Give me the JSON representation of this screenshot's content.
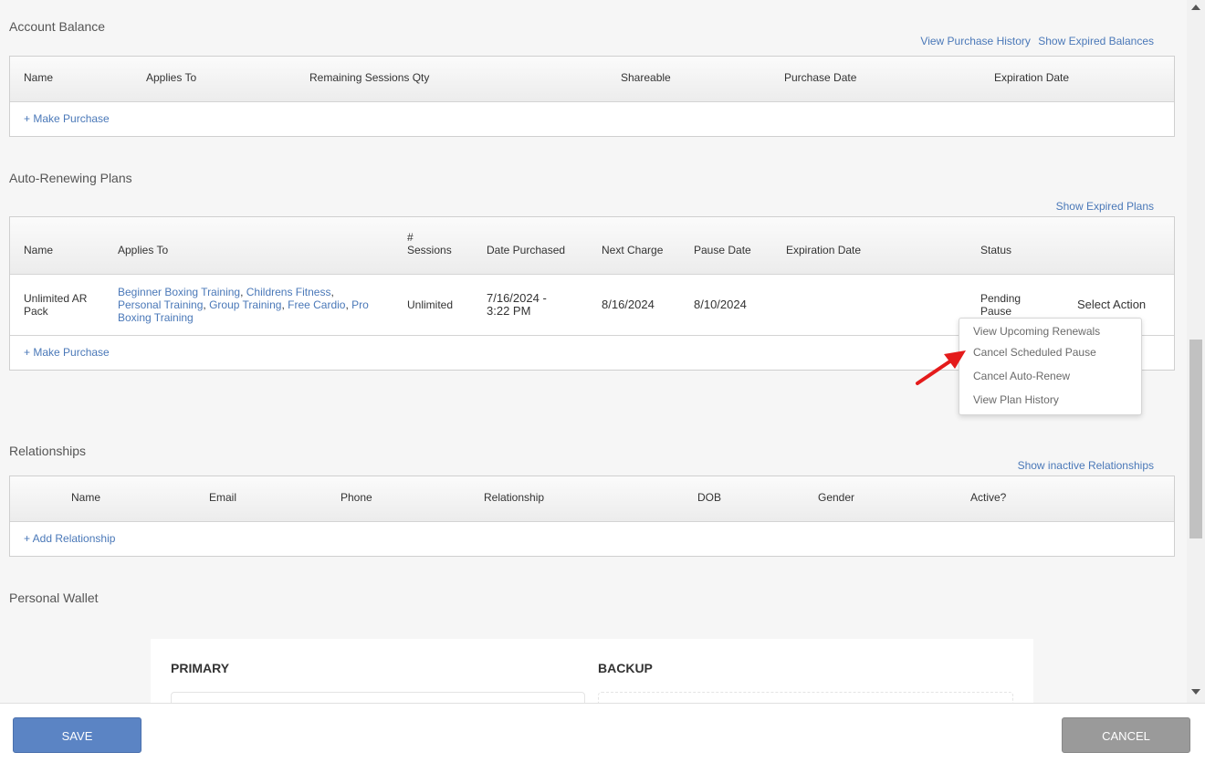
{
  "account_balance": {
    "title": "Account Balance",
    "links": [
      "View Purchase History",
      "Show Expired Balances"
    ],
    "columns": [
      "Name",
      "Applies To",
      "Remaining Sessions Qty",
      "Shareable",
      "Purchase Date",
      "Expiration Date"
    ],
    "make_purchase": "+ Make Purchase"
  },
  "auto_renewing": {
    "title": "Auto-Renewing Plans",
    "link": "Show Expired Plans",
    "columns": [
      "Name",
      "Applies To",
      "#",
      "Sessions",
      "Date Purchased",
      "Next Charge",
      "Pause Date",
      "Expiration Date",
      "Status"
    ],
    "row": {
      "name_line1": "Unlimited AR",
      "name_line2": "Pack",
      "applies_1": "Beginner Boxing Training",
      "applies_2": "Childrens Fitness",
      "applies_3": "Personal Training",
      "applies_4": "Group Training",
      "applies_5": "Free Cardio",
      "applies_6": "Pro",
      "applies_7": "Boxing Training",
      "sessions": "Unlimited",
      "date_line1": "7/16/2024 -",
      "date_line2": "3:22 PM",
      "next_charge": "8/16/2024",
      "pause_date": "8/10/2024",
      "status_line1": "Pending",
      "status_line2": "Pause",
      "select_action": "Select Action"
    },
    "make_purchase": "+ Make Purchase",
    "menu": [
      "View Upcoming Renewals",
      "Cancel Scheduled Pause",
      "Cancel Auto-Renew",
      "View Plan History"
    ]
  },
  "relationships": {
    "title": "Relationships",
    "link": "Show inactive Relationships",
    "columns": [
      "Name",
      "Email",
      "Phone",
      "Relationship",
      "DOB",
      "Gender",
      "Active?"
    ],
    "add": "+ Add Relationship"
  },
  "wallet": {
    "title": "Personal Wallet",
    "primary": "PRIMARY",
    "backup": "BACKUP"
  },
  "buttons": {
    "save": "SAVE",
    "cancel": "CANCEL"
  },
  "colors": {
    "link": "#4a78b8",
    "save": "#5b84c4",
    "cancel": "#9a9a9a",
    "arrow": "#e41b1b"
  }
}
